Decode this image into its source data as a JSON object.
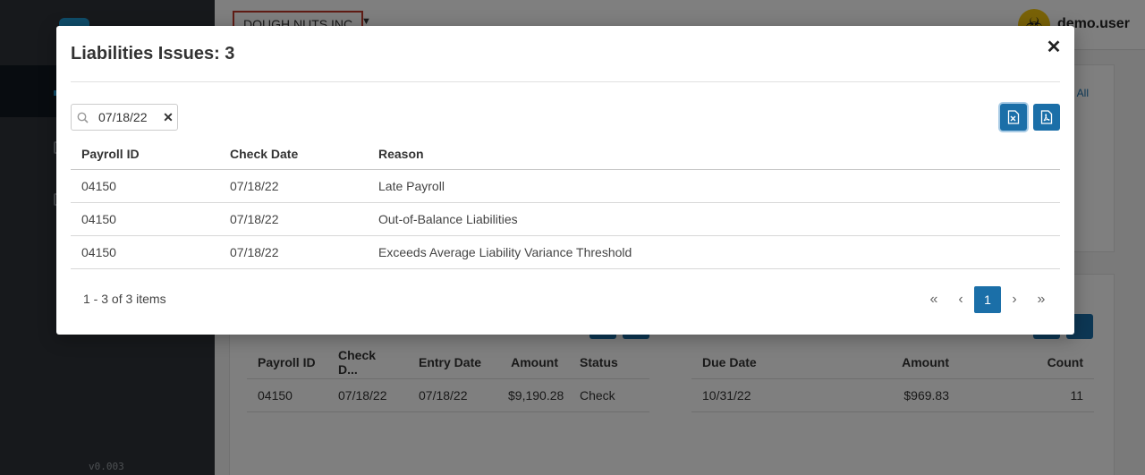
{
  "app": {
    "version": "v0.003",
    "company": "DOUGH NUTS INC",
    "user": "demo.user",
    "view_all": "View All"
  },
  "background": {
    "left_table": {
      "headers": [
        "Payroll ID",
        "Check D...",
        "Entry Date",
        "Amount",
        "Status"
      ],
      "rows": [
        [
          "04150",
          "07/18/22",
          "07/18/22",
          "$9,190.28",
          "Check"
        ]
      ]
    },
    "right_table": {
      "headers": [
        "Due Date",
        "Amount",
        "Count"
      ],
      "rows": [
        [
          "10/31/22",
          "$969.83",
          "11"
        ]
      ]
    }
  },
  "modal": {
    "title": "Liabilities Issues: 3",
    "search_value": "07/18/22",
    "columns": [
      "Payroll ID",
      "Check Date",
      "Reason"
    ],
    "rows": [
      [
        "04150",
        "07/18/22",
        "Late Payroll"
      ],
      [
        "04150",
        "07/18/22",
        "Out-of-Balance Liabilities"
      ],
      [
        "04150",
        "07/18/22",
        "Exceeds Average Liability Variance Threshold"
      ]
    ],
    "pager_info": "1 - 3 of 3 items",
    "current_page": "1"
  },
  "colors": {
    "primary": "#1b6fa8",
    "sidebar": "#2f3338",
    "company_border": "#c0392b",
    "avatar": "#f2c40f"
  },
  "icons": {
    "close": "close-icon",
    "search": "search-icon",
    "clear": "clear-icon",
    "excel": "file-excel-icon",
    "pdf": "file-pdf-icon",
    "first": "chevron-double-left-icon",
    "prev": "chevron-left-icon",
    "next": "chevron-right-icon",
    "last": "chevron-double-right-icon"
  }
}
